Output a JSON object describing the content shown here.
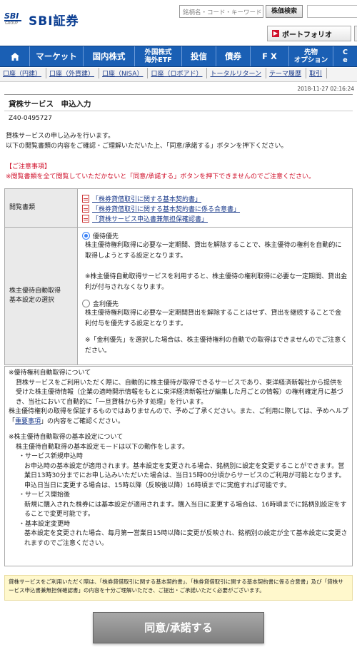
{
  "header": {
    "logo_mark": "SBI",
    "logo_group": "GROUP",
    "logo_text": "SBI証券",
    "search_placeholder": "銘柄名・コード・キーワード",
    "search_button": "株価検索",
    "portfolio_button": "ポートフォリオ"
  },
  "nav": {
    "items": [
      "マーケット",
      "国内株式",
      "外国株式\n海外ETF",
      "投信",
      "債券",
      "F X",
      "先物\nオプション",
      "C\ne"
    ]
  },
  "subnav": {
    "items": [
      "口座（円建）",
      "口座（外貨建）",
      "口座（NISA）",
      "口座（ロボアド）",
      "トータルリターン",
      "テーマ履歴",
      "取引"
    ]
  },
  "timestamp": "2018-11-27 02:16:24",
  "page_title": "貸株サービス　申込入力",
  "account_no": "Z40-0495727",
  "intro": {
    "line1": "貸株サービスの申し込みを行います。",
    "line2": "以下の閲覧書類の内容をご確認・ご理解いただいた上、「同意/承諾する」ボタンを押下ください。"
  },
  "notice": {
    "head": "【ご注意事項】",
    "body": "※閲覧書類を全て閲覧していただかないと「同意/承諾する」ボタンを押下できませんのでご注意ください。"
  },
  "table": {
    "docs_label": "閲覧書類",
    "docs": [
      "「株券貸借取引に関する基本契約書」",
      "「株券貸借取引に関する基本契約書に係る合意書」",
      "「貸株サービス申込書兼無担保確認書」"
    ],
    "setting_label": "株主優待自動取得\n基本設定の選択",
    "opt1_label": "優待優先",
    "opt1_desc": "株主優待権利取得に必要な一定期間、貸出を解除することで、株主優待の権利を自動的に取得しようとする設定となります。",
    "opt1_note": "※株主優待自動取得サービスを利用すると、株主優待の権利取得に必要な一定期間、貸出金利が付与されなくなります。",
    "opt2_label": "金利優先",
    "opt2_desc": "株主優待権利取得に必要な一定期間貸出を解除することはせず、貸出を継続することで金利付与を優先する設定となります。",
    "opt2_note": "※「金利優先」を選択した場合は、株主優待権利の自動での取得はできませんのでご注意ください。"
  },
  "info": {
    "h1": "※優待権利自動取得について",
    "p1a": "貸株サービスをご利用いただく際に、自動的に株主優待が取得できるサービスであり、東洋経済新報社から提供を受けた株主優待情報（企業の適時開示情報をもとに東洋経済新報社が編集した月ごとの情報）の権利確定月に基づき、当社において自動的に「一旦貸株から外す処理」を行います。",
    "p1b": "株主優待権利の取得を保証するものではありませんので、予めご了承ください。また、ご利用に際しては、予めヘルプ「",
    "p1_link": "重要事項",
    "p1c": "」の内容をご確認ください。",
    "h2": "※株主優待自動取得の基本設定について",
    "p2": "株主優待自動取得の基本設定モードは以下の動作をします。",
    "s1": "・サービス新規申込時",
    "s1_body": "お申込時の基本設定が適用されます。基本設定を変更される場合、銘柄別に設定を変更することができます。営業日13時30分までにお申し込みいただいた場合は、当日15時00分頃からサービスのご利用が可能となります。申込日当日に変更する場合は、15時以降（反映後以降）16時頃までに実施すれば可能です。",
    "s2": "・サービス開始後",
    "s2_body": "新規に購入された株券には基本設定が適用されます。購入当日に変更する場合は、16時頃までに銘柄別設定をすることで変更可能です。",
    "s3": "・基本設定変更時",
    "s3_body": "基本設定を変更された場合、毎月第一営業日15時以降に変更が反映され、銘柄別の設定が全て基本設定に変更されますのでご注意ください。"
  },
  "yellow_note": "貸株サービスをご利用いただく際は、「株券貸借取引に関する基本契約書」、「株券貸借取引に関する基本契約書に係る合意書」及び「貸株サービス申込書兼無担保確認書」の内容を十分ご理解いただき、ご提出・ご承諾いただく必要がございます。",
  "submit_label": "同意/承諾する"
}
